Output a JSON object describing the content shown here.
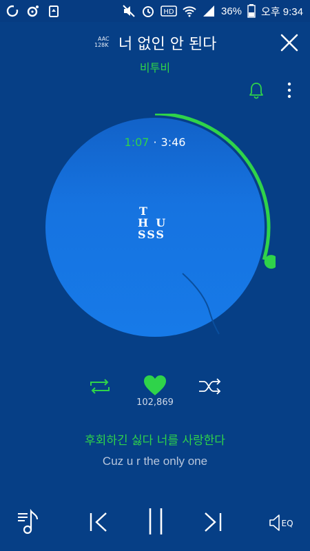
{
  "status_bar": {
    "battery": "36%",
    "time": "오후 9:34",
    "hd_label": "HD"
  },
  "header": {
    "codec_line1": "AAC",
    "codec_line2": "128K",
    "song_title": "너 없인 안 된다",
    "artist": "비투비"
  },
  "player": {
    "elapsed": "1:07",
    "separator": "·",
    "duration": "3:46",
    "progress": 0.296,
    "like_count": "102,869"
  },
  "album_art": {
    "line1": "T",
    "line2": "H  U",
    "line3": "SSS"
  },
  "lyrics": {
    "current": "후회하긴 싫다 너를 사랑한다",
    "translation": "Cuz u r the only one"
  },
  "bottom_bar": {
    "eq_label": "EQ"
  },
  "colors": {
    "background": "#063f86",
    "accent": "#2fd34a",
    "disc": "#177ae8"
  }
}
